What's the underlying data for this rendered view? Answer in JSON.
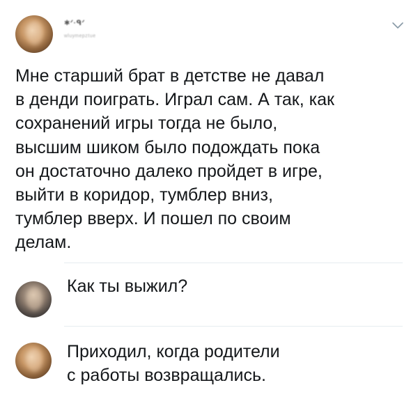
{
  "tweet": {
    "author_name": "✱ᐟ·ᑫᐟ",
    "author_handle": "ʷˡᵘʸᵐᵉᵖᶻᵗᵘᵉ",
    "text": "Мне старший брат в детстве не давал\nв денди поиграть. Играл сам. А так, как\nсохранений игры тогда не было,\nвысшим шиком было подождать пока\nон достаточно далеко пройдет в игре,\nвыйти в коридор, тумблер вниз,\nтумблер вверх. И пошел по своим\nделам.",
    "menu_icon": "chevron-down-icon"
  },
  "replies": [
    {
      "text": "Как ты выжил?"
    },
    {
      "text": "Приходил, когда родители\nс работы возвращались."
    }
  ],
  "colors": {
    "text": "#14171a",
    "divider": "#e6ecf0",
    "chevron": "#8899a6"
  }
}
